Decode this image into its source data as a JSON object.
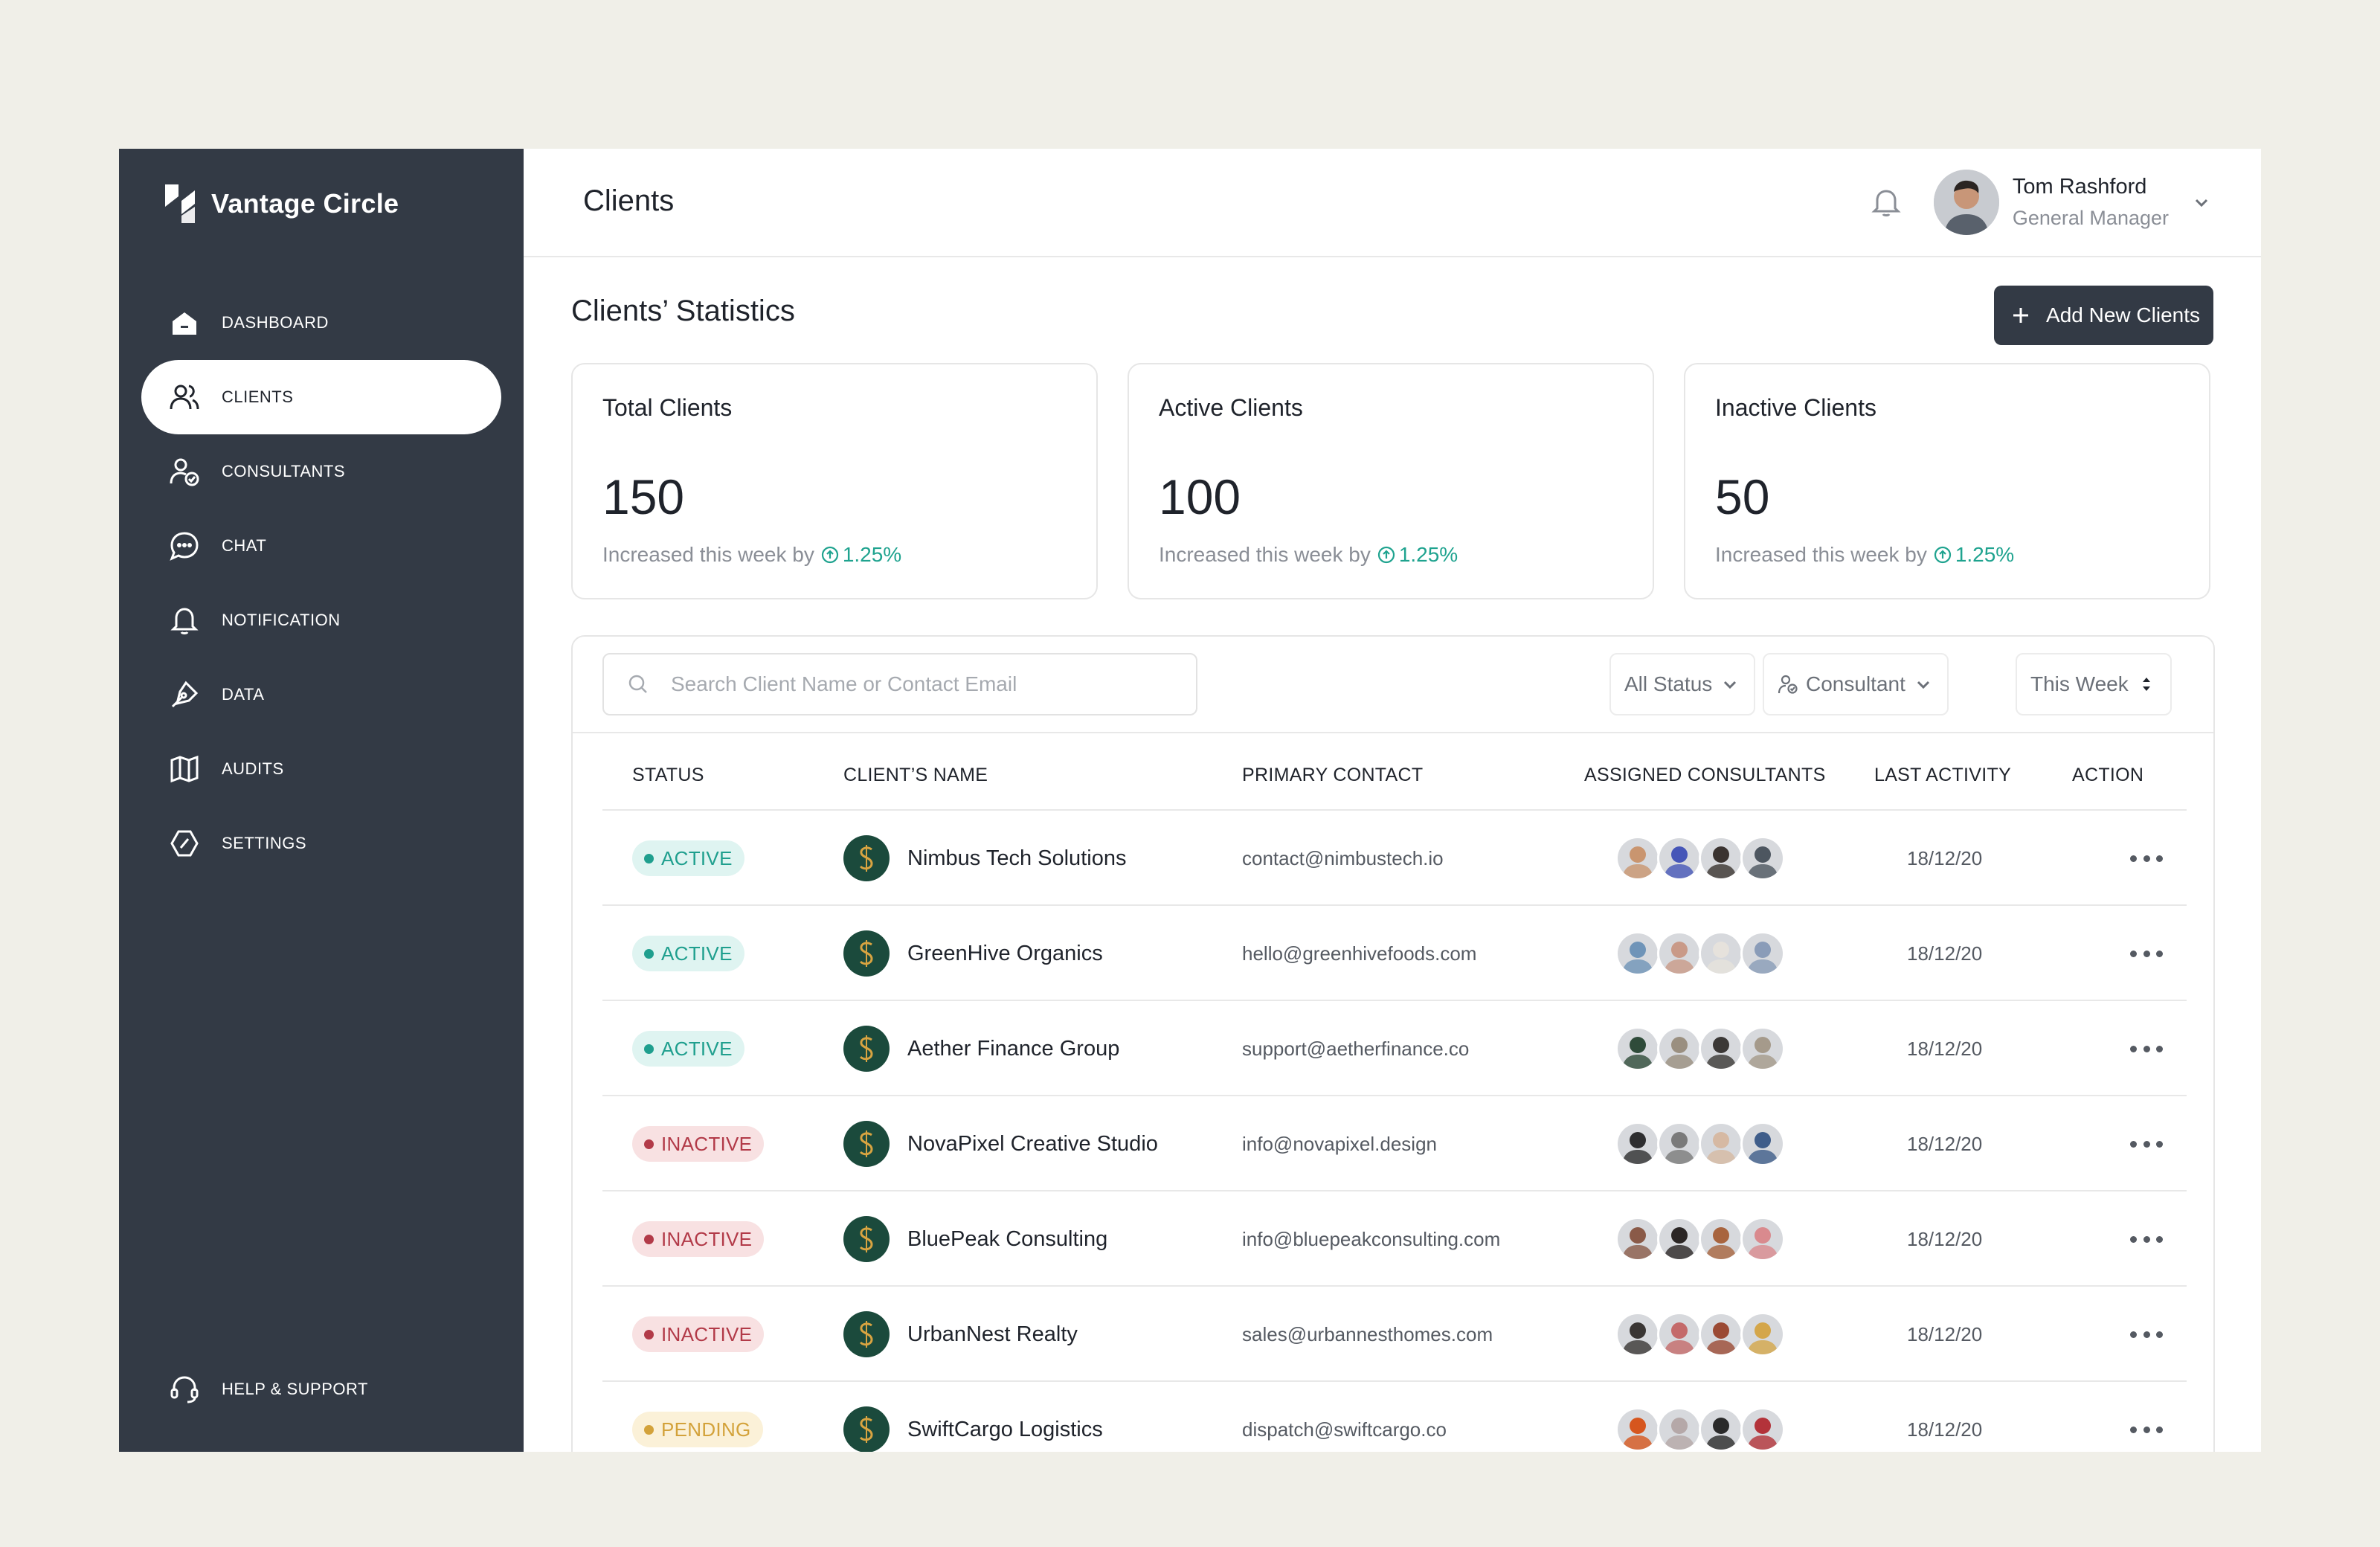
{
  "brand": {
    "name": "Vantage Circle"
  },
  "sidebar": {
    "items": [
      {
        "label": "DASHBOARD",
        "icon": "home-icon"
      },
      {
        "label": "CLIENTS",
        "icon": "users-icon"
      },
      {
        "label": "CONSULTANTS",
        "icon": "user-check-icon"
      },
      {
        "label": "CHAT",
        "icon": "chat-icon"
      },
      {
        "label": "NOTIFICATION",
        "icon": "bell-icon"
      },
      {
        "label": "DATA",
        "icon": "pen-tool-icon"
      },
      {
        "label": "AUDITS",
        "icon": "map-icon"
      },
      {
        "label": "SETTINGS",
        "icon": "settings-icon"
      }
    ],
    "help": "HELP & SUPPORT"
  },
  "header": {
    "title": "Clients",
    "user_name": "Tom Rashford",
    "user_role": "General Manager"
  },
  "stats": {
    "title": "Clients’ Statistics",
    "add_button": "Add New Clients",
    "cards": [
      {
        "label": "Total Clients",
        "value": "150",
        "note": "Increased this week by",
        "delta": "1.25%"
      },
      {
        "label": "Active Clients",
        "value": "100",
        "note": "Increased this week by",
        "delta": "1.25%"
      },
      {
        "label": "Inactive Clients",
        "value": "50",
        "note": "Increased this week by",
        "delta": "1.25%"
      }
    ]
  },
  "filters": {
    "search_placeholder": "Search Client Name or Contact Email",
    "status": "All Status",
    "consultant": "Consultant",
    "period": "This Week"
  },
  "table": {
    "columns": [
      "STATUS",
      "CLIENT’S NAME",
      "PRIMARY CONTACT",
      "ASSIGNED CONSULTANTS",
      "LAST ACTIVITY",
      "ACTION"
    ],
    "rows": [
      {
        "status": "ACTIVE",
        "name": "Nimbus Tech Solutions",
        "contact": "contact@nimbustech.io",
        "date": "18/12/20",
        "avatars": [
          "#c9956f",
          "#4656b8",
          "#3a3330",
          "#4d5660"
        ]
      },
      {
        "status": "ACTIVE",
        "name": "GreenHive Organics",
        "contact": "hello@greenhivefoods.com",
        "date": "18/12/20",
        "avatars": [
          "#6f94b8",
          "#c99a88",
          "#e6e2dc",
          "#8a9cb8"
        ]
      },
      {
        "status": "ACTIVE",
        "name": "Aether Finance Group",
        "contact": "support@aetherfinance.co",
        "date": "18/12/20",
        "avatars": [
          "#2f4b3a",
          "#9a8f80",
          "#3b3836",
          "#a59a8b"
        ]
      },
      {
        "status": "INACTIVE",
        "name": "NovaPixel Creative Studio",
        "contact": "info@novapixel.design",
        "date": "18/12/20",
        "avatars": [
          "#2e2e30",
          "#7a7a7a",
          "#d6b9a3",
          "#3f5d8a"
        ]
      },
      {
        "status": "INACTIVE",
        "name": "BluePeak Consulting",
        "contact": "info@bluepeakconsulting.com",
        "date": "18/12/20",
        "avatars": [
          "#8a5a48",
          "#2b2625",
          "#a8643e",
          "#d98a8e"
        ]
      },
      {
        "status": "INACTIVE",
        "name": "UrbanNest Realty",
        "contact": "sales@urbannesthomes.com",
        "date": "18/12/20",
        "avatars": [
          "#3a3634",
          "#c46a6a",
          "#9b4a34",
          "#d4a64a"
        ]
      },
      {
        "status": "PENDING",
        "name": "SwiftCargo Logistics",
        "contact": "dispatch@swiftcargo.co",
        "date": "18/12/20",
        "avatars": [
          "#d6561e",
          "#b5a8a8",
          "#2a2a2a",
          "#b3333a"
        ]
      }
    ]
  },
  "colors": {
    "sidebar": "#333a45",
    "accent": "#1fa38f",
    "active": "#1f9f8e",
    "inactive": "#b23a48",
    "pending": "#d3a23a"
  }
}
